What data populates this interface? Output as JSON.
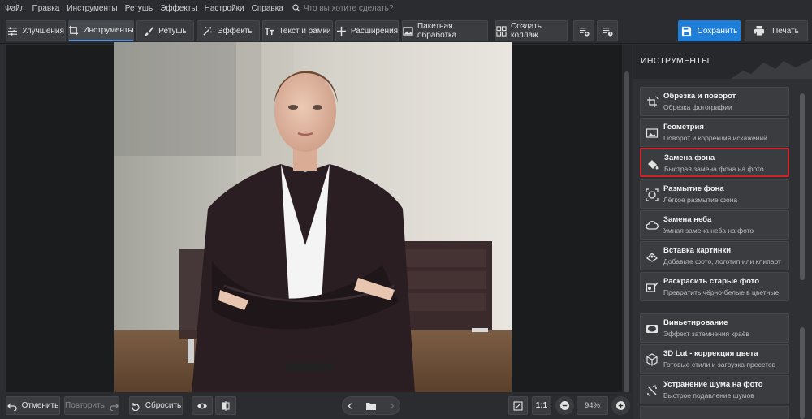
{
  "menu": [
    "Файл",
    "Правка",
    "Инструменты",
    "Ретушь",
    "Эффекты",
    "Настройки",
    "Справка"
  ],
  "search": {
    "placeholder": "Что вы хотите сделать?"
  },
  "tabs": {
    "enhance": "Улучшения",
    "tools": "Инструменты",
    "retouch": "Ретушь",
    "effects": "Эффекты",
    "text": "Текст и рамки",
    "extensions": "Расширения",
    "batch": "Пакетная обработка",
    "collage": "Создать коллаж"
  },
  "actions": {
    "save": "Сохранить",
    "print": "Печать"
  },
  "panel": {
    "title": "ИНСТРУМЕНТЫ",
    "tools": [
      {
        "title": "Обрезка и поворот",
        "subtitle": "Обрезка фотографии",
        "icon": "crop-rotate-icon"
      },
      {
        "title": "Геометрия",
        "subtitle": "Поворот и коррекция искажений",
        "icon": "geometry-icon"
      },
      {
        "title": "Замена фона",
        "subtitle": "Быстрая замена фона на фото",
        "icon": "paint-bucket-icon",
        "selected": true
      },
      {
        "title": "Размытие фона",
        "subtitle": "Лёгкое размытие фона",
        "icon": "blur-background-icon"
      },
      {
        "title": "Замена неба",
        "subtitle": "Умная замена неба на фото",
        "icon": "cloud-icon"
      },
      {
        "title": "Вставка картинки",
        "subtitle": "Добавьте фото, логотип или клипарт",
        "icon": "insert-image-icon"
      },
      {
        "title": "Раскрасить старые фото",
        "subtitle": "Превратить чёрно-белые в цветные",
        "icon": "colorize-icon"
      },
      {
        "title": "Виньетирование",
        "subtitle": "Эффект затемнения краёв",
        "icon": "vignette-icon"
      },
      {
        "title": "3D Lut - коррекция цвета",
        "subtitle": "Готовые стили и загрузка пресетов",
        "icon": "cube-icon"
      },
      {
        "title": "Устранение шума на фото",
        "subtitle": "Быстрое подавление шумов",
        "icon": "denoise-icon"
      }
    ]
  },
  "bottom": {
    "undo": "Отменить",
    "redo": "Повторить",
    "reset": "Сбросить",
    "ratio": "1:1",
    "zoom": "94%"
  },
  "colors": {
    "accent": "#1f7ed8",
    "highlight": "#d42127",
    "background": "#2b2d30"
  }
}
